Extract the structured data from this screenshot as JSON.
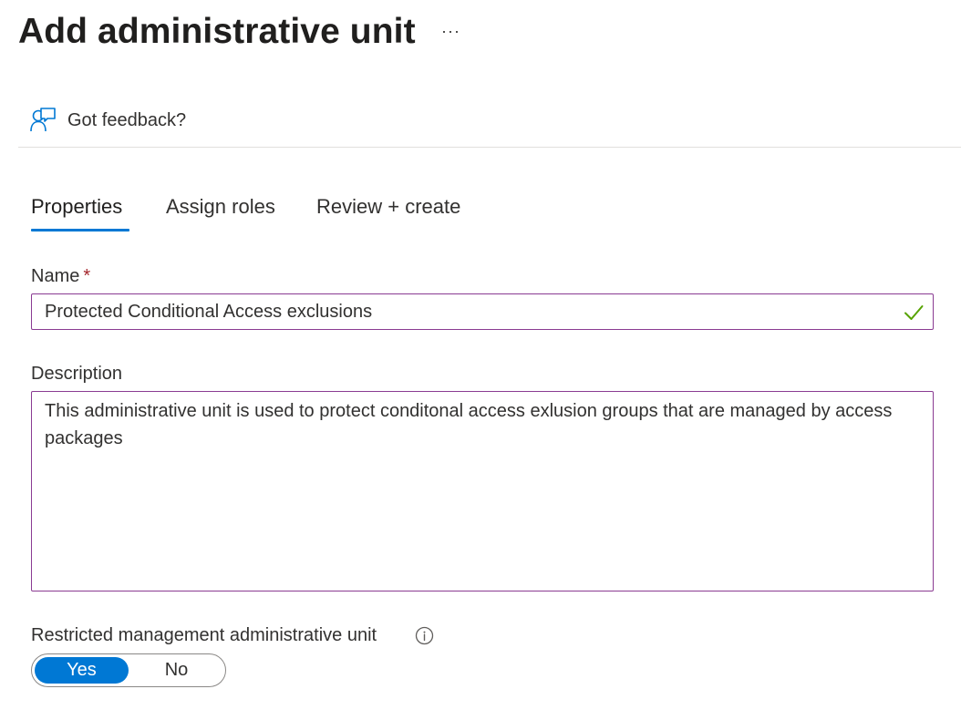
{
  "header": {
    "title": "Add administrative unit",
    "more_label": "···"
  },
  "feedback": {
    "label": "Got feedback?",
    "icon": "feedback-person-icon"
  },
  "tabs": [
    {
      "label": "Properties",
      "active": true
    },
    {
      "label": "Assign roles",
      "active": false
    },
    {
      "label": "Review + create",
      "active": false
    }
  ],
  "form": {
    "name": {
      "label": "Name",
      "required_marker": "*",
      "value": "Protected Conditional Access exclusions",
      "valid_icon": "checkmark-icon"
    },
    "description": {
      "label": "Description",
      "value": "This administrative unit is used to protect conditonal access exlusion groups that are managed by access packages"
    },
    "restricted": {
      "label": "Restricted management administrative unit",
      "info_icon": "info-icon",
      "options": [
        "Yes",
        "No"
      ],
      "selected": "Yes"
    }
  },
  "colors": {
    "accent": "#0078d4",
    "input_border": "#8a3b92",
    "valid_check": "#57a300",
    "required": "#a4262c"
  }
}
